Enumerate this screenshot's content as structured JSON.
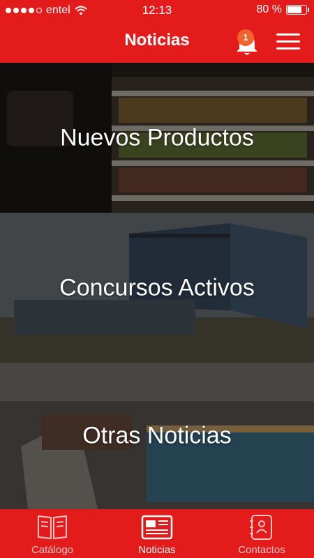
{
  "status_bar": {
    "carrier": "entel",
    "time": "12:13",
    "battery_percent_text": "80 %",
    "battery_level": 0.8,
    "signal_bars": 4
  },
  "nav": {
    "title": "Noticias",
    "notification_count": "1",
    "icons": [
      "bell-icon",
      "hamburger-menu-icon"
    ]
  },
  "tiles": [
    {
      "label": "Nuevos Productos",
      "image": "supermarket-shelves-photo"
    },
    {
      "label": "Concursos Activos",
      "image": "glass-building-photo"
    },
    {
      "label": "Otras Noticias",
      "image": "warehouse-photo"
    }
  ],
  "tabbar": {
    "tabs": [
      {
        "label": "Catálogo",
        "icon": "book-icon",
        "active": false
      },
      {
        "label": "Noticias",
        "icon": "newspaper-icon",
        "active": true
      },
      {
        "label": "Contactos",
        "icon": "contacts-book-icon",
        "active": false
      }
    ]
  },
  "colors": {
    "brand_red": "#e31b1b",
    "badge_orange": "#f0642c"
  }
}
